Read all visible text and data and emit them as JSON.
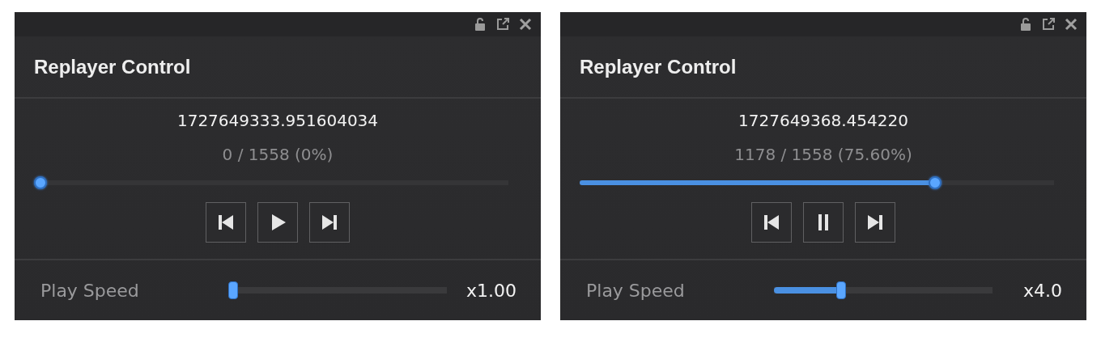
{
  "panels": [
    {
      "title": "Replayer Control",
      "timestamp": "1727649333.951604034",
      "progress_text": "0 / 1558 (0%)",
      "progress": {
        "level": 0
      },
      "playing": false,
      "speed_label": "Play Speed",
      "speed": {
        "level": 0
      },
      "speed_value": "x1.00"
    },
    {
      "title": "Replayer Control",
      "timestamp": "1727649368.454220",
      "progress_text": "1178 / 1558 (75.60%)",
      "progress": {
        "level": 0.756
      },
      "playing": true,
      "speed_label": "Play Speed",
      "speed": {
        "level": 0.3
      },
      "speed_value": "x4.0"
    }
  ]
}
